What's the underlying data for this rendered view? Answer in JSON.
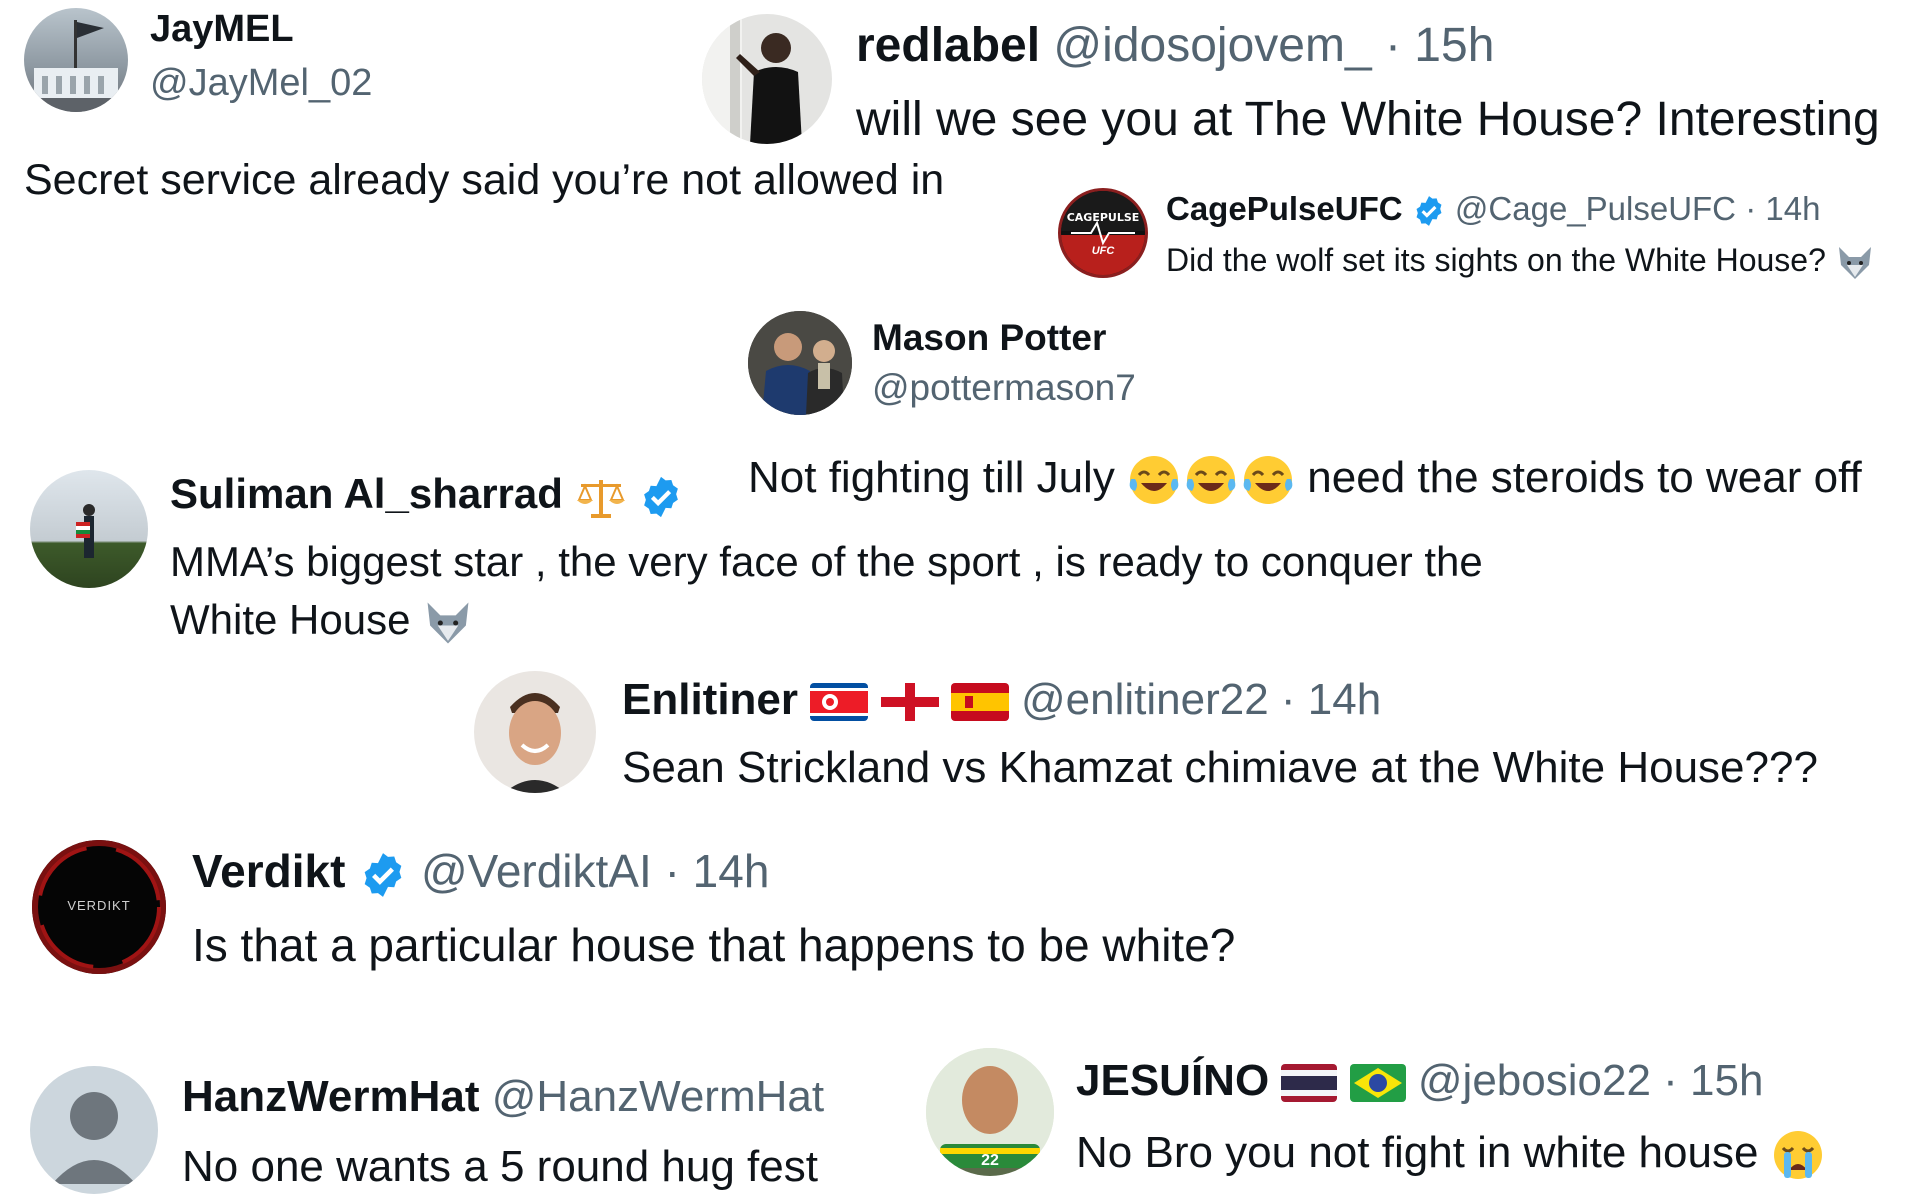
{
  "tweets": {
    "jaymel": {
      "name": "JayMEL",
      "handle": "@JayMel_02",
      "text": "Secret service already said you’re not allowed in"
    },
    "redlabel": {
      "name": "redlabel",
      "handle": "@idosojovem_",
      "time": "· 15h",
      "text": "will we see you at The White House? Interesting"
    },
    "cagepulse": {
      "name": "CagePulseUFC",
      "handle": "@Cage_PulseUFC",
      "time": "· 14h",
      "text": "Did the wolf set its sights on the White House?",
      "avatar_text_top": "CAGEPULSE",
      "avatar_text_bottom": "UFC"
    },
    "mason": {
      "name": "Mason Potter",
      "handle": "@pottermason7",
      "text": "Not fighting till July",
      "text_after": "need the steroids to wear off"
    },
    "suliman": {
      "name": "Suliman Al_sharrad",
      "text_line1": "MMA’s biggest star , the very face of the sport , is ready to conquer the",
      "text_line2": "White House"
    },
    "enlitiner": {
      "name": "Enlitiner",
      "handle": "@enlitiner22",
      "time": "· 14h",
      "text": "Sean Strickland vs Khamzat chimiave at the White House???"
    },
    "verdikt": {
      "name": "Verdikt",
      "handle": "@VerdiktAI",
      "time": "· 14h",
      "text": "Is that a particular house that happens to be white?",
      "avatar_text": "VERDIKT"
    },
    "hanz": {
      "name": "HanzWermHat",
      "handle": "@HanzWermHat",
      "text": "No one wants a 5 round hug fest"
    },
    "jesuino": {
      "name": "JESUÍNO",
      "handle": "@jebosio22",
      "time": "· 15h",
      "text": "No Bro you not fight in white house",
      "avatar_badge": "22"
    }
  },
  "icons": [
    "verified-badge-icon",
    "balance-scale-icon",
    "wolf-emoji-icon",
    "tears-of-joy-emoji-icon",
    "loudly-crying-emoji-icon",
    "north-korea-flag-icon",
    "england-flag-icon",
    "spain-flag-icon",
    "thailand-flag-icon",
    "brazil-flag-icon"
  ],
  "colors": {
    "text": "#0f1419",
    "secondary": "#536471",
    "verified": "#1d9bf0"
  }
}
